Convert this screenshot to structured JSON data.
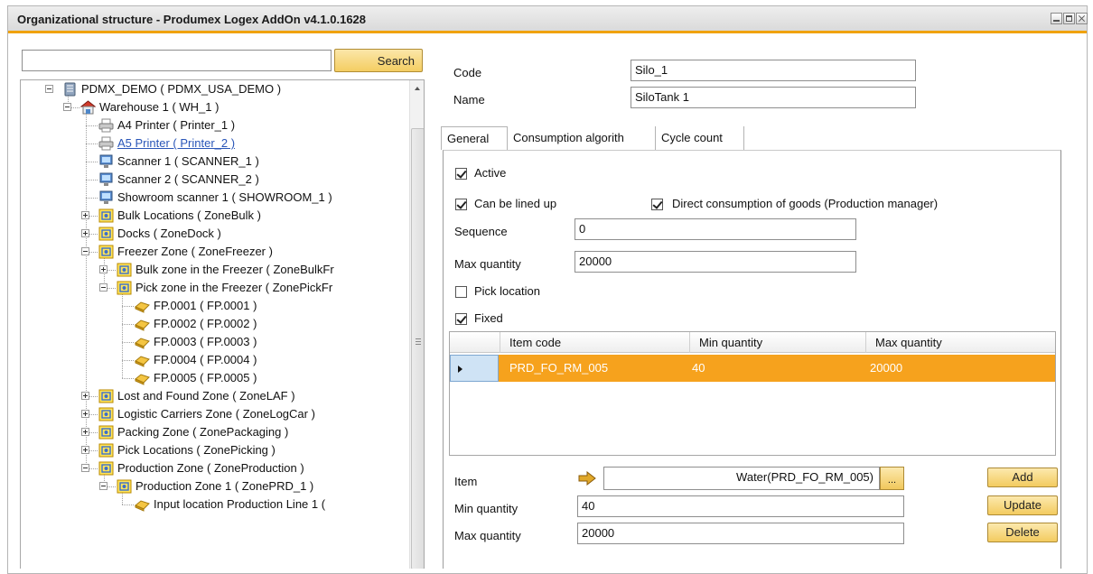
{
  "window": {
    "title": "Organizational structure - Produmex Logex AddOn v4.1.0.1628",
    "controls": [
      "minimize",
      "maximize",
      "close"
    ]
  },
  "search": {
    "value": "",
    "button_label": "Search"
  },
  "tree": {
    "items": [
      {
        "label": "PDMX_DEMO ( PDMX_USA_DEMO )",
        "icon": "database-icon",
        "expander": "minus"
      },
      {
        "label": "Warehouse 1 ( WH_1 )",
        "icon": "warehouse-icon",
        "expander": "minus"
      },
      {
        "label": "A4 Printer ( Printer_1 )",
        "icon": "printer-icon"
      },
      {
        "label": "A5 Printer ( Printer_2 )",
        "icon": "printer-icon",
        "selected": true
      },
      {
        "label": "Scanner 1 ( SCANNER_1 )",
        "icon": "computer-icon"
      },
      {
        "label": "Scanner 2 ( SCANNER_2 )",
        "icon": "computer-icon"
      },
      {
        "label": "Showroom scanner 1 ( SHOWROOM_1 )",
        "icon": "computer-icon"
      },
      {
        "label": "Bulk Locations ( ZoneBulk )",
        "icon": "zone-icon",
        "expander": "plus"
      },
      {
        "label": "Docks ( ZoneDock )",
        "icon": "zone-icon",
        "expander": "plus"
      },
      {
        "label": "Freezer Zone ( ZoneFreezer )",
        "icon": "zone-icon",
        "expander": "minus"
      },
      {
        "label": "Bulk zone in the Freezer ( ZoneBulkFr",
        "icon": "zone-icon",
        "expander": "plus"
      },
      {
        "label": "Pick zone in the Freezer ( ZonePickFr",
        "icon": "zone-icon",
        "expander": "minus"
      },
      {
        "label": "FP.0001 ( FP.0001 )",
        "icon": "location-icon"
      },
      {
        "label": "FP.0002 ( FP.0002 )",
        "icon": "location-icon"
      },
      {
        "label": "FP.0003 ( FP.0003 )",
        "icon": "location-icon"
      },
      {
        "label": "FP.0004 ( FP.0004 )",
        "icon": "location-icon"
      },
      {
        "label": "FP.0005 ( FP.0005 )",
        "icon": "location-icon"
      },
      {
        "label": "Lost and Found Zone ( ZoneLAF )",
        "icon": "zone-icon",
        "expander": "plus"
      },
      {
        "label": "Logistic Carriers Zone ( ZoneLogCar )",
        "icon": "zone-icon",
        "expander": "plus"
      },
      {
        "label": "Packing Zone ( ZonePackaging )",
        "icon": "zone-icon",
        "expander": "plus"
      },
      {
        "label": "Pick Locations ( ZonePicking )",
        "icon": "zone-icon",
        "expander": "plus"
      },
      {
        "label": "Production Zone ( ZoneProduction )",
        "icon": "zone-icon",
        "expander": "minus"
      },
      {
        "label": "Production Zone 1 ( ZonePRD_1 )",
        "icon": "zone-icon",
        "expander": "minus"
      },
      {
        "label": "Input location Production Line 1 (",
        "icon": "location-icon"
      }
    ]
  },
  "form": {
    "code_label": "Code",
    "code_value": "Silo_1",
    "name_label": "Name",
    "name_value": "SiloTank 1"
  },
  "tabs": [
    {
      "label": "General",
      "active": true
    },
    {
      "label": "Consumption algorith"
    },
    {
      "label": "Cycle count"
    }
  ],
  "general": {
    "active_label": "Active",
    "active_checked": true,
    "lined_up_label": "Can be lined up",
    "lined_up_checked": true,
    "direct_label": "Direct consumption of goods (Production manager)",
    "direct_checked": true,
    "sequence_label": "Sequence",
    "sequence_value": "0",
    "max_qty_label": "Max quantity",
    "max_qty_value": "20000",
    "pick_label": "Pick location",
    "pick_checked": false,
    "fixed_label": "Fixed",
    "fixed_checked": true
  },
  "grid": {
    "columns": [
      "Item code",
      "Min quantity",
      "Max quantity"
    ],
    "rows": [
      {
        "item_code": "PRD_FO_RM_005",
        "min_qty": "40",
        "max_qty": "20000",
        "selected": true
      }
    ],
    "selected_color": "#f6a21d"
  },
  "item_editor": {
    "item_label": "Item",
    "item_value": "Water(PRD_FO_RM_005)",
    "ellipsis_label": "...",
    "min_label": "Min quantity",
    "min_value": "40",
    "max_label": "Max quantity",
    "max_value": "20000",
    "add_label": "Add",
    "update_label": "Update",
    "delete_label": "Delete"
  },
  "colors": {
    "accent": "#f0a20a",
    "button_yellow": "#f4cd62",
    "link": "#2a56b8"
  }
}
